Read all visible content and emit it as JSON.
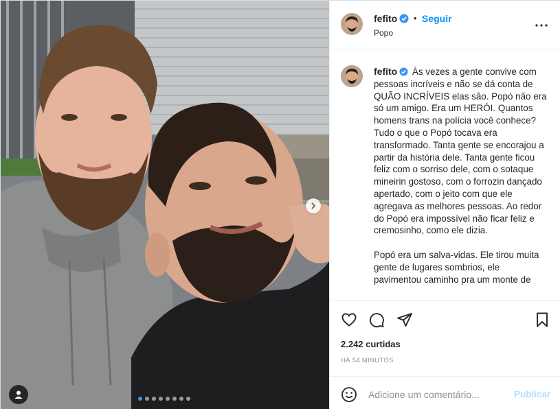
{
  "post": {
    "username": "fefito",
    "follow_label": "Seguir",
    "bullet": "•",
    "location": "Popo"
  },
  "caption": {
    "username": "fefito",
    "paragraph1": "Às vezes a gente convive com pessoas incríveis e não se dá conta de QUÃO INCRÍVEIS elas são. Popó não era só um amigo. Era um HERÓI. Quantos homens trans na polícia você conhece? Tudo o que o Popó tocava era transformado. Tanta gente se encorajou a partir da história dele. Tanta gente ficou feliz com o sorriso dele, com o sotaque mineirin gostoso, com o forrozin dançado apertado, com o jeito com que ele agregava as melhores pessoas. Ao redor do Popó era impossível não ficar feliz e cremosinho, como ele dizia.",
    "paragraph2": "Popó era um salva-vidas. Ele tirou muita gente de lugares sombrios, ele pavimentou caminho pra um monte de"
  },
  "stats": {
    "likes": "2.242 curtidas",
    "time": "HÁ 54 MINUTOS"
  },
  "comment_box": {
    "placeholder": "Adicione um comentário...",
    "publish_label": "Publicar"
  },
  "carousel": {
    "dot_count": 8,
    "active_index": 0
  },
  "icons": {
    "verified": "verified-badge-icon",
    "more": "more-options-icon",
    "like": "heart-icon",
    "comment": "comment-bubble-icon",
    "share": "paper-plane-icon",
    "save": "bookmark-icon",
    "emoji": "smiley-icon",
    "next": "chevron-right-icon",
    "tags": "user-tag-icon"
  },
  "colors": {
    "link_blue": "#0095f6",
    "verified_blue": "#3897f0",
    "publish_disabled": "#b2dffc",
    "muted": "#8e8e8e"
  }
}
